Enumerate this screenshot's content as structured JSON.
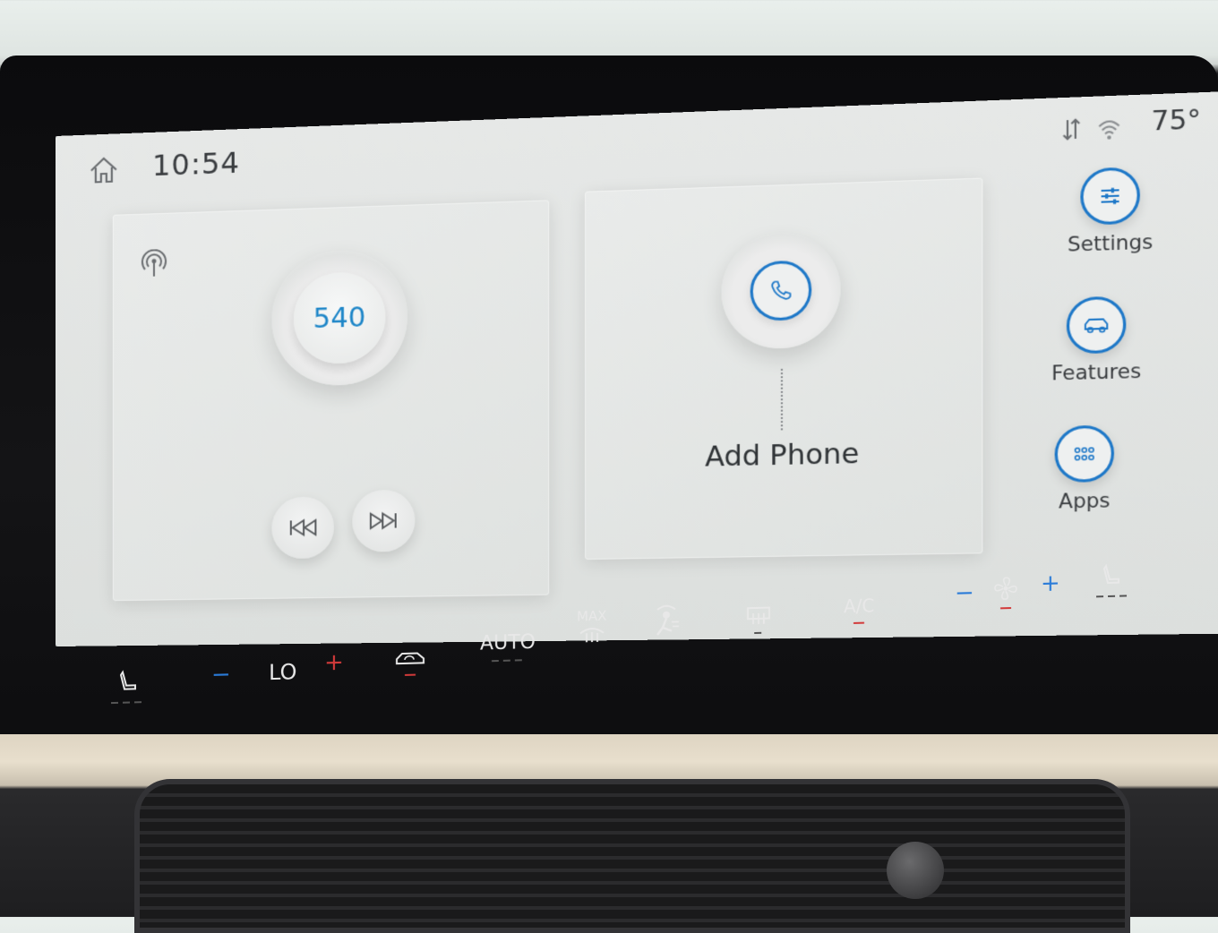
{
  "status_bar": {
    "time": "10:54",
    "temperature": "75°",
    "icons": [
      "home-icon",
      "data-transfer-icon",
      "wifi-icon"
    ]
  },
  "radio": {
    "frequency": "540",
    "icons": [
      "radio-signal-icon",
      "previous-track-icon",
      "next-track-icon"
    ]
  },
  "phone": {
    "label": "Add Phone",
    "icon": "phone-icon"
  },
  "side_menu": {
    "items": [
      {
        "label": "Settings",
        "icon": "settings-sliders-icon"
      },
      {
        "label": "Features",
        "icon": "vehicle-icon"
      },
      {
        "label": "Apps",
        "icon": "apps-grid-icon"
      }
    ]
  },
  "climate": {
    "minus": "−",
    "temp_setting": "LO",
    "plus": "+",
    "auto": "AUTO",
    "max": "MAX",
    "ac": "A/C",
    "fan_minus": "−",
    "fan_plus": "+",
    "icons": [
      "heated-seat-left-icon",
      "recirculation-icon",
      "max-defrost-icon",
      "airflow-person-icon",
      "rear-defrost-icon",
      "fan-icon",
      "heated-seat-right-icon"
    ]
  },
  "colors": {
    "accent_blue": "#1e78c8",
    "indicator_red": "#d23a3a",
    "screen_bg": "#e2e4e3"
  }
}
